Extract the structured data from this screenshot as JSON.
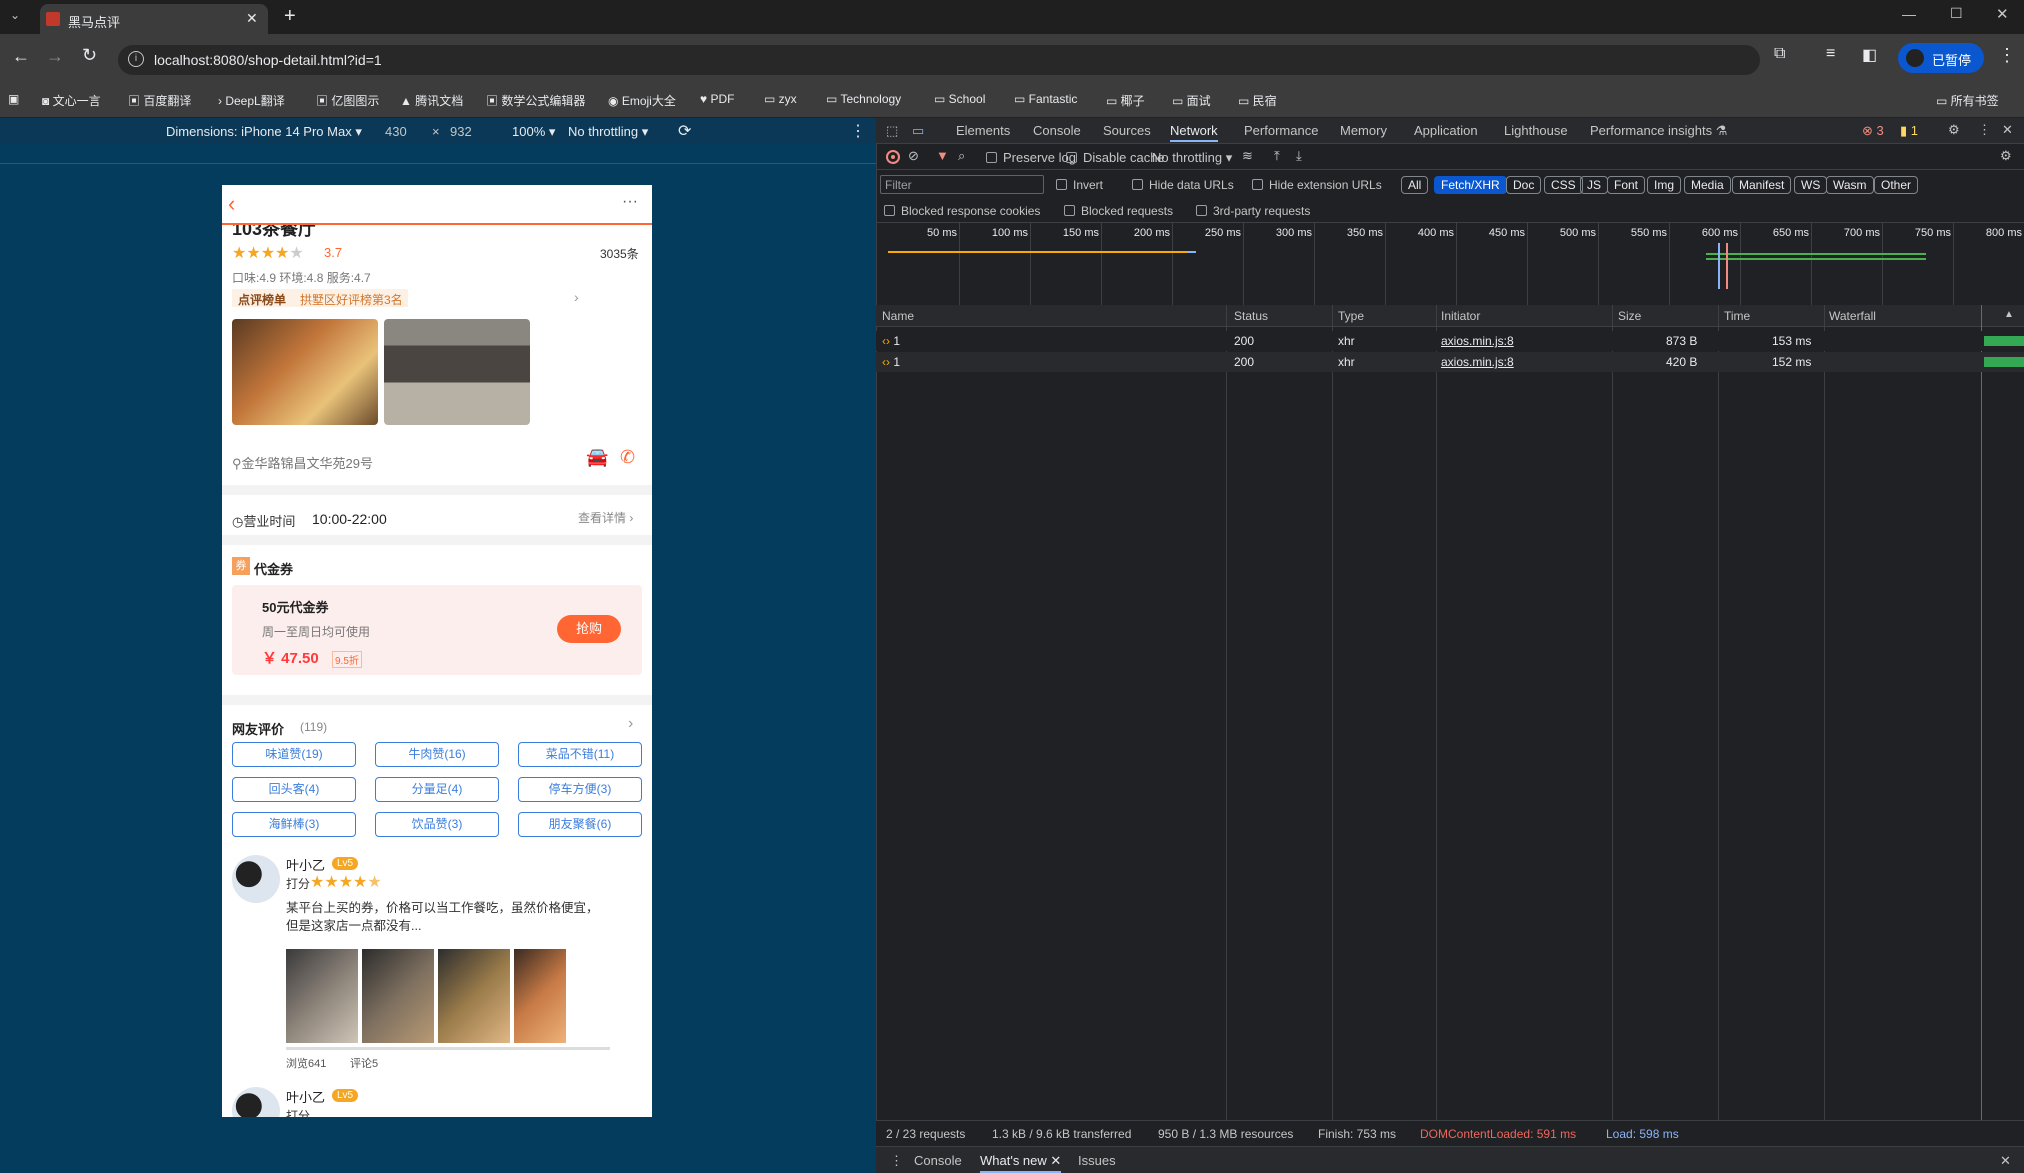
{
  "browser": {
    "tab_title": "黑马点评",
    "url": "localhost:8080/shop-detail.html?id=1",
    "profile_label": "已暂停",
    "bookmarks": [
      "文心一言",
      "百度翻译",
      "DeepL翻译",
      "亿图图示",
      "腾讯文档",
      "数学公式编辑器",
      "Emoji大全",
      "PDF",
      "zyx",
      "Technology",
      "School",
      "Fantastic",
      "椰子",
      "面试",
      "民宿"
    ],
    "all_bookmarks": "所有书签"
  },
  "emulation": {
    "device": "Dimensions: iPhone 14 Pro Max",
    "width": "430",
    "times": "×",
    "height": "932",
    "zoom": "100%",
    "throttle": "No throttling"
  },
  "devtools": {
    "tabs": [
      "Elements",
      "Console",
      "Sources",
      "Network",
      "Performance",
      "Memory",
      "Application",
      "Lighthouse",
      "Performance insights"
    ],
    "active_tab": "Network",
    "errors": "3",
    "warnings": "1",
    "toolbar": {
      "preserve_log": "Preserve log",
      "disable_cache": "Disable cache",
      "throttle": "No throttling"
    },
    "filter_placeholder": "Filter",
    "invert": "Invert",
    "hide_data_urls": "Hide data URLs",
    "hide_ext_urls": "Hide extension URLs",
    "types": [
      "All",
      "Fetch/XHR",
      "Doc",
      "CSS",
      "JS",
      "Font",
      "Img",
      "Media",
      "Manifest",
      "WS",
      "Wasm",
      "Other"
    ],
    "active_type": "Fetch/XHR",
    "blocked_cookies": "Blocked response cookies",
    "blocked_requests": "Blocked requests",
    "third_party": "3rd-party requests",
    "ticks": [
      "50 ms",
      "100 ms",
      "150 ms",
      "200 ms",
      "250 ms",
      "300 ms",
      "350 ms",
      "400 ms",
      "450 ms",
      "500 ms",
      "550 ms",
      "600 ms",
      "650 ms",
      "700 ms",
      "750 ms",
      "800 ms"
    ],
    "columns": [
      "Name",
      "Status",
      "Type",
      "Initiator",
      "Size",
      "Time",
      "Waterfall"
    ],
    "rows": [
      {
        "name": "1",
        "status": "200",
        "type": "xhr",
        "initiator": "axios.min.js:8",
        "size": "873 B",
        "time": "153 ms"
      },
      {
        "name": "1",
        "status": "200",
        "type": "xhr",
        "initiator": "axios.min.js:8",
        "size": "420 B",
        "time": "152 ms"
      }
    ],
    "status": {
      "requests": "2 / 23 requests",
      "transferred": "1.3 kB / 9.6 kB transferred",
      "resources": "950 B / 1.3 MB resources",
      "finish": "Finish: 753 ms",
      "dcl": "DOMContentLoaded: 591 ms",
      "load": "Load: 598 ms"
    },
    "drawer": [
      "Console",
      "What's new",
      "Issues"
    ]
  },
  "shop": {
    "name": "103茶餐厅",
    "rating": "3.7",
    "stars": 3.7,
    "comments": "3035条",
    "scores": "口味:4.9 环境:4.8 服务:4.7",
    "rank_label": "点评榜单",
    "rank_text": "拱墅区好评榜第3名",
    "address": "金华路锦昌文华苑29号",
    "hours_label": "营业时间",
    "hours": "10:00-22:00",
    "hours_more": "查看详情",
    "voucher_icon": "券",
    "voucher_title": "代金券",
    "voucher_name": "50元代金券",
    "voucher_desc": "周一至周日均可使用",
    "voucher_price": "￥ 47.50",
    "voucher_discount": "9.5折",
    "buy": "抢购",
    "review_title": "网友评价",
    "review_count": "(119)",
    "tags": [
      "味道赞(19)",
      "牛肉赞(16)",
      "菜品不错(11)",
      "回头客(4)",
      "分量足(4)",
      "停车方便(3)",
      "海鲜棒(3)",
      "饮品赞(3)",
      "朋友聚餐(6)"
    ],
    "review": {
      "user": "叶小乙",
      "level": "Lv5",
      "score_label": "打分",
      "stars": 4.5,
      "text1": "某平台上买的券，价格可以当工作餐吃，虽然价格便宜，",
      "text2": "但是这家店一点都没有...",
      "views": "浏览641",
      "comments": "评论5"
    },
    "review2": {
      "user": "叶小乙",
      "level": "Lv5",
      "score_label": "打分"
    }
  },
  "colors": {
    "accent": "#ff6633",
    "blue": "#3b7ddd",
    "devtools_bg": "#202124",
    "emu_bg": "#033c5c"
  }
}
